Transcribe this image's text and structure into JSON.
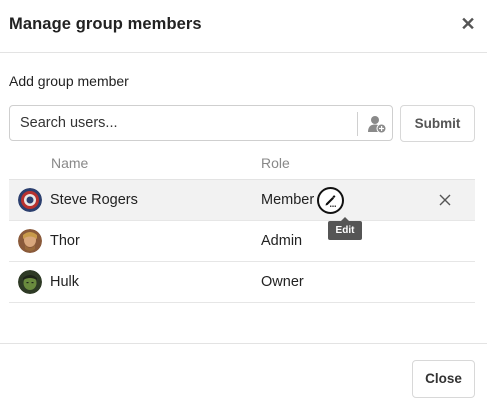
{
  "dialog": {
    "title": "Manage group members",
    "close_icon": "close-icon"
  },
  "add_member": {
    "label": "Add group member",
    "search_placeholder": "Search users...",
    "search_value": "",
    "add_user_icon": "add-user-icon",
    "submit_label": "Submit"
  },
  "table": {
    "columns": [
      "Name",
      "Role"
    ],
    "rows": [
      {
        "name": "Steve Rogers",
        "role": "Member",
        "avatar_color": "#2b3f6e"
      },
      {
        "name": "Thor",
        "role": "Admin",
        "avatar_color": "#8a5a3a"
      },
      {
        "name": "Hulk",
        "role": "Owner",
        "avatar_color": "#3f6a2e"
      }
    ],
    "edit_icon": "pencil-icon",
    "remove_icon": "close-icon"
  },
  "tooltip": {
    "text": "Edit"
  },
  "footer": {
    "close_label": "Close"
  },
  "colors": {
    "hover_row": "#f2f2f2",
    "tooltip_bg": "#555555",
    "border": "#e3e3e3"
  }
}
